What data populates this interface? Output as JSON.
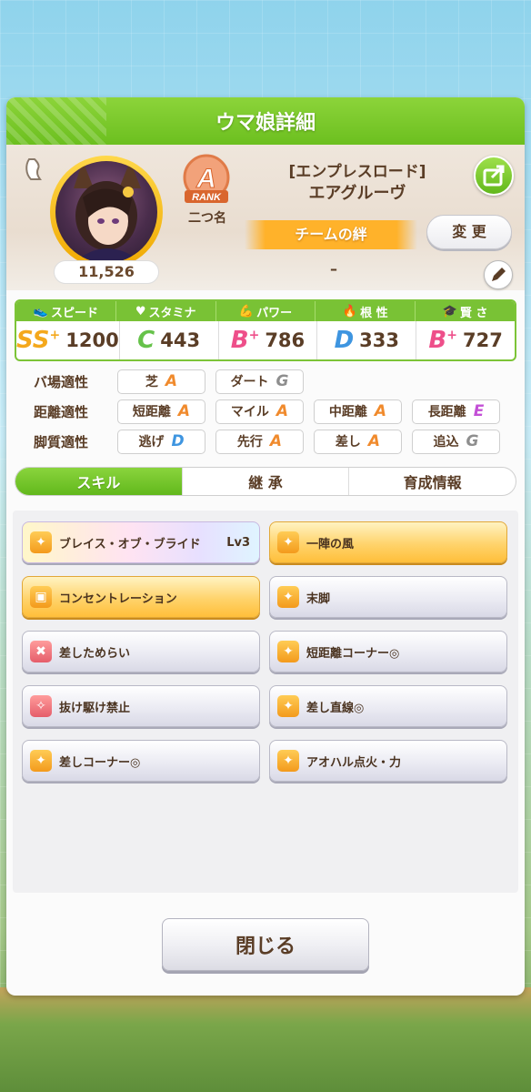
{
  "dialog": {
    "title": "ウマ娘詳細"
  },
  "character": {
    "title": "[エンプレスロード]",
    "name": "エアグルーヴ",
    "fans": "11,526",
    "rank": "A",
    "rank_word": "RANK",
    "rank_label": "二つ名",
    "portrait": "character-portrait"
  },
  "team": {
    "label": "チームの絆",
    "value": "–",
    "change_label": "変 更"
  },
  "stats": [
    {
      "label": "スピード",
      "icon": "shoe-icon",
      "grade": "SS",
      "plus": "+",
      "value": "1200",
      "color": "#f4a81c"
    },
    {
      "label": "スタミナ",
      "icon": "heart-icon",
      "grade": "C",
      "plus": "",
      "value": "443",
      "color": "#66c24a"
    },
    {
      "label": "パワー",
      "icon": "muscle-icon",
      "grade": "B",
      "plus": "+",
      "value": "786",
      "color": "#ee4f8a"
    },
    {
      "label": "根 性",
      "icon": "flame-icon",
      "grade": "D",
      "plus": "",
      "value": "333",
      "color": "#3e95e0"
    },
    {
      "label": "賢 さ",
      "icon": "mortarboard-icon",
      "grade": "B",
      "plus": "+",
      "value": "727",
      "color": "#ee4f8a"
    }
  ],
  "aptitude": {
    "track": {
      "label": "バ場適性",
      "items": [
        {
          "name": "芝",
          "grade": "A"
        },
        {
          "name": "ダート",
          "grade": "G"
        }
      ]
    },
    "distance": {
      "label": "距離適性",
      "items": [
        {
          "name": "短距離",
          "grade": "A"
        },
        {
          "name": "マイル",
          "grade": "A"
        },
        {
          "name": "中距離",
          "grade": "A"
        },
        {
          "name": "長距離",
          "grade": "E"
        }
      ]
    },
    "style": {
      "label": "脚質適性",
      "items": [
        {
          "name": "逃げ",
          "grade": "D"
        },
        {
          "name": "先行",
          "grade": "A"
        },
        {
          "name": "差し",
          "grade": "A"
        },
        {
          "name": "追込",
          "grade": "G"
        }
      ]
    }
  },
  "tabs": [
    {
      "label": "スキル",
      "active": true
    },
    {
      "label": "継 承",
      "active": false
    },
    {
      "label": "育成情報",
      "active": false
    }
  ],
  "skills": [
    {
      "name": "ブレイス・オブ・ブライド",
      "level": "Lv3",
      "style": "rainbow",
      "icon": "orange"
    },
    {
      "name": "一陣の風",
      "level": "",
      "style": "gold",
      "icon": "orange"
    },
    {
      "name": "コンセントレーション",
      "level": "",
      "style": "gold",
      "icon": "orange"
    },
    {
      "name": "末脚",
      "level": "",
      "style": "normal",
      "icon": "orange"
    },
    {
      "name": "差しためらい",
      "level": "",
      "style": "normal",
      "icon": "red"
    },
    {
      "name": "短距離コーナー◎",
      "level": "",
      "style": "normal",
      "icon": "orange"
    },
    {
      "name": "抜け駆け禁止",
      "level": "",
      "style": "normal",
      "icon": "red"
    },
    {
      "name": "差し直線◎",
      "level": "",
      "style": "normal",
      "icon": "orange"
    },
    {
      "name": "差しコーナー◎",
      "level": "",
      "style": "normal",
      "icon": "orange"
    },
    {
      "name": "アオハル点火・力",
      "level": "",
      "style": "normal",
      "icon": "orange"
    }
  ],
  "close_label": "閉じる",
  "grade_colors": {
    "A": "#f08a2c",
    "E": "#c34fd6",
    "G": "#8e8e8e",
    "D": "#3e95e0"
  }
}
